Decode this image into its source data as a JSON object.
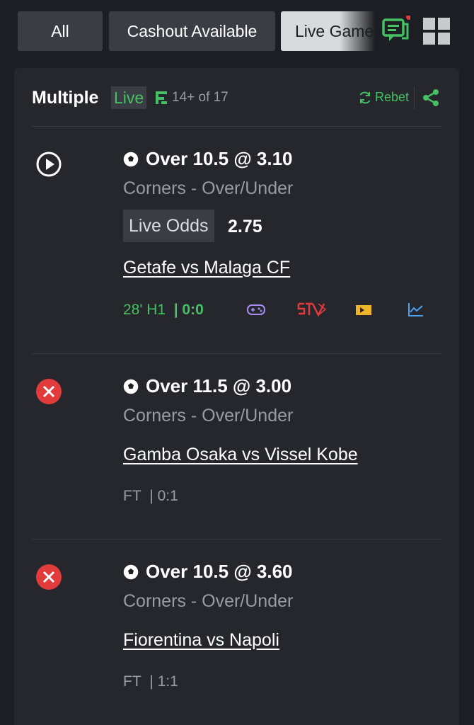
{
  "filters": [
    {
      "label": "All"
    },
    {
      "label": "Cashout Available"
    },
    {
      "label": "Live Games"
    }
  ],
  "header": {
    "title": "Multiple",
    "live_badge": "Live",
    "legs_count": "14+ of 17",
    "rebet_label": "Rebet"
  },
  "icons": {
    "chat": "chat-notification-icon",
    "grid": "grid-view-icon",
    "share": "share-icon",
    "rebet": "refresh-icon"
  },
  "colors": {
    "background": "#1c1e23",
    "card": "#25272d",
    "accent_green": "#45c063",
    "lost_red": "#e23b3b",
    "muted": "#9a9ca2"
  },
  "legs": [
    {
      "status": "live",
      "selection": "Over 10.5 @ 3.10",
      "market": "Corners - Over/Under",
      "live_odds_label": "Live Odds",
      "live_odds_value": "2.75",
      "match": "Getafe vs Malaga CF",
      "time": "28' H1",
      "score": "| 0:0"
    },
    {
      "status": "lost",
      "selection": "Over 11.5 @ 3.00",
      "market": "Corners - Over/Under",
      "match": "Gamba Osaka vs Vissel Kobe",
      "time": "FT",
      "score": "| 0:1"
    },
    {
      "status": "lost",
      "selection": "Over 10.5 @ 3.60",
      "market": "Corners - Over/Under",
      "match": "Fiorentina vs Napoli",
      "time": "FT",
      "score": "| 1:1"
    }
  ]
}
